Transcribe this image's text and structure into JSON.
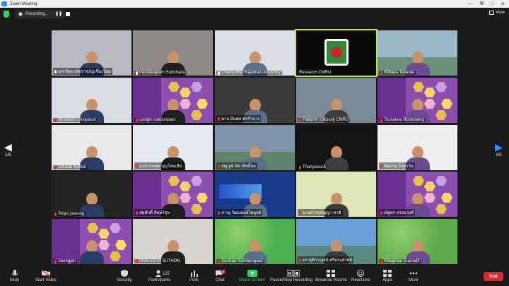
{
  "window": {
    "title": "Zoom Meeting"
  },
  "recording": {
    "label": "Recording..."
  },
  "view": {
    "label": "View"
  },
  "pager": {
    "left": "1/5",
    "right": "1/5"
  },
  "participants": [
    {
      "name": "มหาวิทยาลัยราชภัฏเชียงใหม่",
      "scene": "office",
      "mic": "muted-white",
      "bg": "#b8b8c0"
    },
    {
      "name": "Patcharaporn Sudchada",
      "scene": "person",
      "mic": "muted-white",
      "bg": "#8e8a86"
    },
    {
      "name": "Chiang Mai Rajabhat University",
      "scene": "banner",
      "mic": "muted-white",
      "bg": "#d8dde6"
    },
    {
      "name": "Research CMRU",
      "scene": "logo",
      "mic": "none",
      "bg": "#0a0a0a",
      "active": true
    },
    {
      "name": "Wittaya Tanaree",
      "scene": "city",
      "mic": "muted",
      "bg": "#9ab7c8"
    },
    {
      "name": "khontaros chaiyasut",
      "scene": "person",
      "mic": "muted",
      "bg": "#d9dce2"
    },
    {
      "name": "sasipin sukbunpant",
      "scene": "hex",
      "mic": "muted",
      "bg": "#8c4fb0"
    },
    {
      "name": "นาย มีนพล พรรำนาง",
      "scene": "room",
      "mic": "muted",
      "bg": "#3a3a3a"
    },
    {
      "name": "Pattanin sukpanij CMRU",
      "scene": "person",
      "mic": "muted",
      "bg": "#7a8a96"
    },
    {
      "name": "Tassanee Boonraeng",
      "scene": "hex",
      "mic": "muted",
      "bg": "#8c4fb0"
    },
    {
      "name": "Chusak Kodsiri",
      "scene": "person",
      "mic": "muted",
      "bg": "#e8e8e8"
    },
    {
      "name": "อ.ดร.ธนพล บุญโสมเสือ",
      "scene": "banner",
      "mic": "muted",
      "bg": "#e6e9ef"
    },
    {
      "name": "ณัฐวุฒิ ศิลาสิทธิ์ผล",
      "scene": "campus",
      "mic": "muted",
      "bg": "#7d93a8"
    },
    {
      "name": "Thanyanuch",
      "scene": "person",
      "mic": "muted",
      "bg": "#141414"
    },
    {
      "name": "Natcha ใจตาวัน",
      "scene": "drawing",
      "mic": "muted",
      "bg": "#efefef"
    },
    {
      "name": "Siriya yuwong",
      "scene": "person",
      "mic": "muted",
      "bg": "#242424"
    },
    {
      "name": "สมศักดิ์ จันทร์สุข",
      "scene": "hex",
      "mic": "muted",
      "bg": "#8c4fb0"
    },
    {
      "name": "ภาณุ วัฒนพงษ์ไพบูลย์",
      "scene": "science",
      "mic": "muted",
      "bg": "#1a3b8a"
    },
    {
      "name": "นางสาวสุกัญญา ทาติ",
      "scene": "flowers",
      "mic": "muted",
      "bg": "#dfe7b8"
    },
    {
      "name": "ณัฐพร ธรรมวงศ์",
      "scene": "hex",
      "mic": "muted",
      "bg": "#8c4fb0"
    },
    {
      "name": "Saengjan",
      "scene": "hex",
      "mic": "muted",
      "bg": "#8c4fb0"
    },
    {
      "name": "PRIRACHA SUTHON",
      "scene": "plant",
      "mic": "muted",
      "bg": "#d9d4cc"
    },
    {
      "name": "Sasikan Numbongsod",
      "scene": "green",
      "mic": "muted",
      "bg": "#4caf50"
    },
    {
      "name": "ดร.ชุติกาญจน์ ศรีประสาทย์",
      "scene": "lake",
      "mic": "muted",
      "bg": "#6aa0d6"
    },
    {
      "name": "Wilaiphee Supradit",
      "scene": "garden",
      "mic": "muted",
      "bg": "#5fa84e"
    }
  ],
  "toolbar": {
    "mute": "Mute",
    "start_video": "Start Video",
    "security": "Security",
    "participants": "Participants",
    "participants_count": "125",
    "polls": "Polls",
    "chat": "Chat",
    "chat_badge": "2",
    "share_screen": "Share Screen",
    "pause_recording": "Pause/Stop Recording",
    "breakout": "Breakout Rooms",
    "reactions": "Reactions",
    "apps": "Apps",
    "more": "More",
    "end": "End"
  },
  "colors": {
    "accent": "#2d8cff",
    "end": "#e02828",
    "share": "#23d959",
    "active_border": "#c9e24b"
  }
}
